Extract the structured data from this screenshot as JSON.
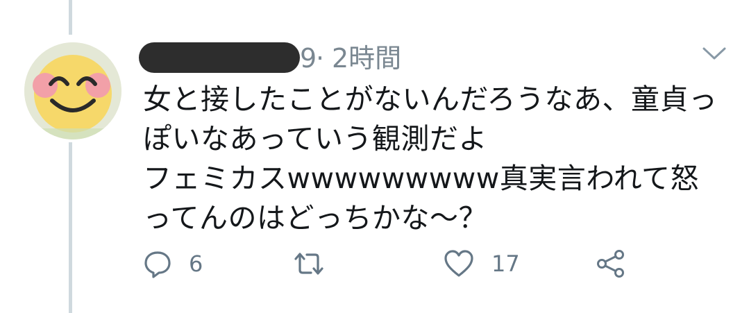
{
  "tweet": {
    "handle_suffix": "9",
    "separator": "·",
    "timestamp": "2時間",
    "text_lines": [
      "女と接したことがないんだろうなあ、童貞っ",
      "ぽいなあっていう観測だよ",
      "フェミカスwwwwwwwww真実言われて怒",
      "ってんのはどっちかな〜？"
    ]
  },
  "actions": {
    "reply_count": "6",
    "retweet_count": "",
    "like_count": "17"
  },
  "colors": {
    "text": "#14171a",
    "muted": "#657786",
    "thread_line": "#cfd9de",
    "redaction": "#2d2d2d"
  },
  "icons": [
    "reply-icon",
    "retweet-icon",
    "like-icon",
    "share-icon",
    "chevron-down-icon"
  ]
}
